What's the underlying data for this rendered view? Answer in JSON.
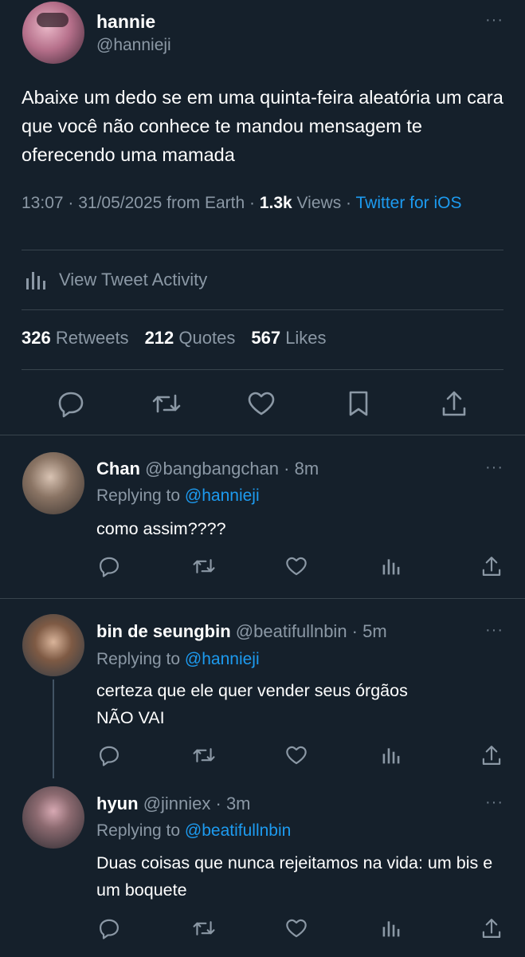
{
  "main_tweet": {
    "name": "hannie",
    "handle": "@hannieji",
    "text": "Abaixe um dedo se em uma quinta-feira aleatória um cara que você não conhece te mandou mensagem te oferecendo uma mamada",
    "meta_time": "13:07 · 31/05/2025 from Earth · ",
    "views_count": "1.3k",
    "views_label": " Views · ",
    "client": "Twitter for iOS",
    "activity_label": "View Tweet Activity",
    "retweets_count": "326",
    "retweets_label": "Retweets",
    "quotes_count": "212",
    "quotes_label": "Quotes",
    "likes_count": "567",
    "likes_label": "Likes"
  },
  "replies": [
    {
      "name": "Chan",
      "handle": "@bangbangchan · 8m",
      "replying_prefix": "Replying to ",
      "replying_to": "@hannieji",
      "text": "como assim????"
    },
    {
      "name": "bin de seungbin",
      "handle": "@beatifullnbin · 5m",
      "replying_prefix": "Replying to ",
      "replying_to": "@hannieji",
      "text_line1": "certeza que ele quer vender seus órgãos",
      "text_line2": "NÃO VAI"
    },
    {
      "name": "hyun",
      "handle": "@jinniex · 3m",
      "replying_prefix": "Replying to ",
      "replying_to": "@beatifullnbin",
      "text": "Duas coisas que nunca rejeitamos na vida: um bis e um boquete"
    }
  ],
  "more_glyph": "···",
  "icons": [
    "reply-icon",
    "retweet-icon",
    "like-icon",
    "bookmark-icon",
    "share-icon",
    "analytics-icon",
    "more-icon"
  ]
}
